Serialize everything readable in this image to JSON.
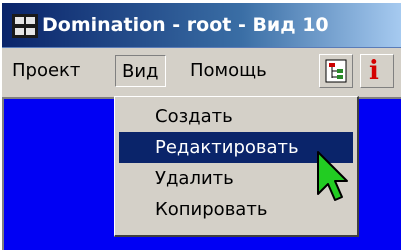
{
  "window": {
    "title": "Domination - root - Вид 10",
    "app_icon": "app-window-icon"
  },
  "menubar": {
    "items": [
      {
        "label": "Проект"
      },
      {
        "label": "Вид",
        "open": true
      },
      {
        "label": "Помощь"
      }
    ],
    "toolbar": [
      {
        "icon": "tree-view-icon"
      },
      {
        "icon": "info-icon",
        "glyph": "i"
      }
    ]
  },
  "dropdown": {
    "items": [
      {
        "label": "Создать"
      },
      {
        "label": "Редактировать",
        "selected": true
      },
      {
        "label": "Удалить"
      },
      {
        "label": "Копировать"
      }
    ]
  },
  "canvas": {
    "background": "#0000f4"
  },
  "colors": {
    "titlebar": "#0a246a",
    "selection": "#0a246a",
    "menu_bg": "#d4d0c8",
    "info_glyph": "#d40000",
    "cursor": "#22cc22"
  }
}
